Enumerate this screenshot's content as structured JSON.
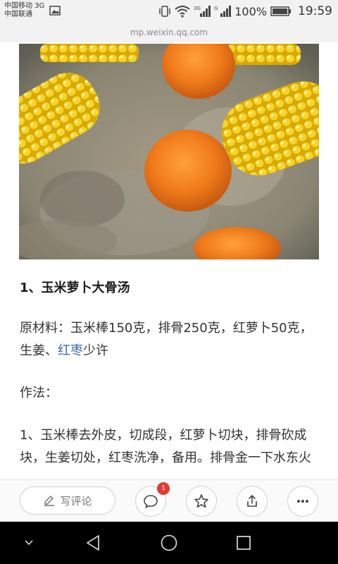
{
  "status_bar": {
    "carrier_1": "中国移动 3G",
    "carrier_2": "中国联通",
    "battery_percent": "100%",
    "time": "19:59",
    "net_1": "3G",
    "net_2": "G"
  },
  "url_bar": {
    "domain": "mp.weixin.qq.com"
  },
  "article": {
    "heading": "1、玉米萝卜大骨汤",
    "ingredients_label": "原材料：",
    "ingredients_text_1": "玉米棒150克，排骨250克，红萝卜50克，生姜、",
    "ingredients_link": "红枣",
    "ingredients_text_2": "少许",
    "method_label": "作法：",
    "step_1": "1、玉米棒去外皮，切成段，红萝卜切块，排骨砍成块，生姜切处，红枣洗净，备用。排骨金一下水东火"
  },
  "action_bar": {
    "write_comment_label": "写评论",
    "comment_count": "1"
  },
  "colors": {
    "link": "#3e6ba4",
    "badge": "#e23b30"
  }
}
